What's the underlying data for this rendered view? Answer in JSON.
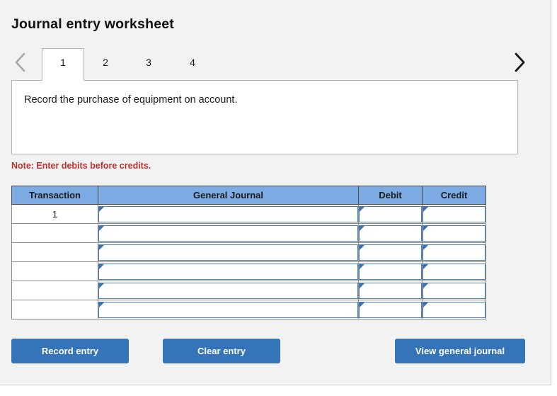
{
  "page": {
    "title": "Journal entry worksheet",
    "background_color": "#F2F2F2",
    "header_blue": "#7BABE2",
    "button_blue": "#3574B8",
    "note_red": "#B8312F"
  },
  "tabs": {
    "prev_icon": "chevron-left-icon",
    "next_icon": "chevron-right-icon",
    "items": [
      {
        "label": "1",
        "active": true
      },
      {
        "label": "2",
        "active": false
      },
      {
        "label": "3",
        "active": false
      },
      {
        "label": "4",
        "active": false
      }
    ]
  },
  "instruction": {
    "text": "Record the purchase of equipment on account."
  },
  "note": {
    "text": "Note: Enter debits before credits."
  },
  "journal_table": {
    "columns": [
      "Transaction",
      "General Journal",
      "Debit",
      "Credit"
    ],
    "rows": [
      {
        "transaction": "1",
        "general_journal": "",
        "debit": "",
        "credit": ""
      },
      {
        "transaction": "",
        "general_journal": "",
        "debit": "",
        "credit": ""
      },
      {
        "transaction": "",
        "general_journal": "",
        "debit": "",
        "credit": ""
      },
      {
        "transaction": "",
        "general_journal": "",
        "debit": "",
        "credit": ""
      },
      {
        "transaction": "",
        "general_journal": "",
        "debit": "",
        "credit": ""
      },
      {
        "transaction": "",
        "general_journal": "",
        "debit": "",
        "credit": ""
      }
    ]
  },
  "actions": {
    "record_entry": "Record entry",
    "clear_entry": "Clear entry",
    "view_general_journal": "View general journal"
  }
}
